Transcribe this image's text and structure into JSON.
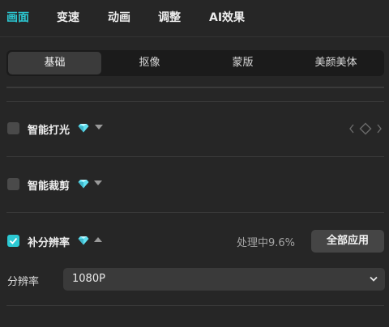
{
  "top_tabs": [
    {
      "label": "画面",
      "active": true
    },
    {
      "label": "变速",
      "active": false
    },
    {
      "label": "动画",
      "active": false
    },
    {
      "label": "调整",
      "active": false
    },
    {
      "label": "AI效果",
      "active": false
    }
  ],
  "sub_tabs": [
    {
      "label": "基础",
      "active": true
    },
    {
      "label": "抠像",
      "active": false
    },
    {
      "label": "蒙版",
      "active": false
    },
    {
      "label": "美颜美体",
      "active": false
    }
  ],
  "features": {
    "smart_light": {
      "label": "智能打光",
      "checked": false,
      "icon": "diamond-icon",
      "caret": "chevron-down-icon"
    },
    "smart_crop": {
      "label": "智能裁剪",
      "checked": false,
      "icon": "diamond-icon",
      "caret": "chevron-down-icon"
    },
    "super_resolution": {
      "label": "补分辨率",
      "checked": true,
      "icon": "diamond-icon",
      "caret": "chevron-up-icon"
    }
  },
  "processing_status": "处理中9.6%",
  "apply_all_label": "全部应用",
  "resolution": {
    "label": "分辨率",
    "value": "1080P"
  },
  "colors": {
    "accent": "#2cc9d3",
    "background": "#262626",
    "vip_diamond": "#5fe0f0"
  }
}
